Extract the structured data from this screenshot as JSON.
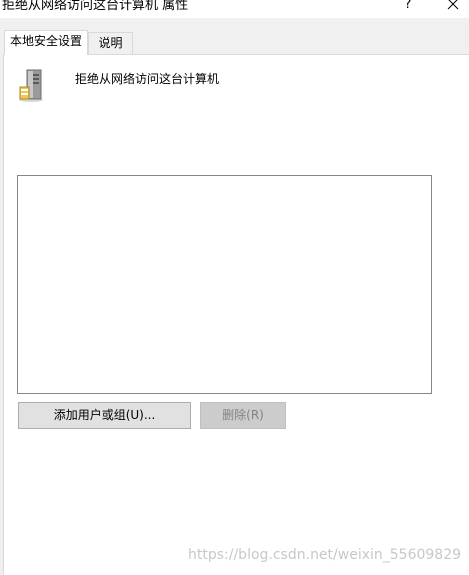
{
  "window": {
    "title": "拒绝从网络访问这台计算机 属性",
    "help_label": "?",
    "close_icon": "close-icon"
  },
  "tabs": [
    {
      "label": "本地安全设置",
      "active": true
    },
    {
      "label": "说明",
      "active": false
    }
  ],
  "policy": {
    "icon": "server-computer-icon",
    "name": "拒绝从网络访问这台计算机"
  },
  "user_list": {
    "items": []
  },
  "buttons": {
    "add_label": "添加用户或组(U)...",
    "remove_label": "删除(R)",
    "remove_enabled": false
  },
  "watermark": {
    "text": "https://blog.csdn.net/weixin_55609829"
  },
  "colors": {
    "dialog_bg": "#f0f0f0",
    "panel_bg": "#ffffff",
    "button_bg": "#e1e1e1",
    "disabled_button_bg": "#cccccc",
    "disabled_text": "#838383",
    "list_border": "#828790"
  }
}
